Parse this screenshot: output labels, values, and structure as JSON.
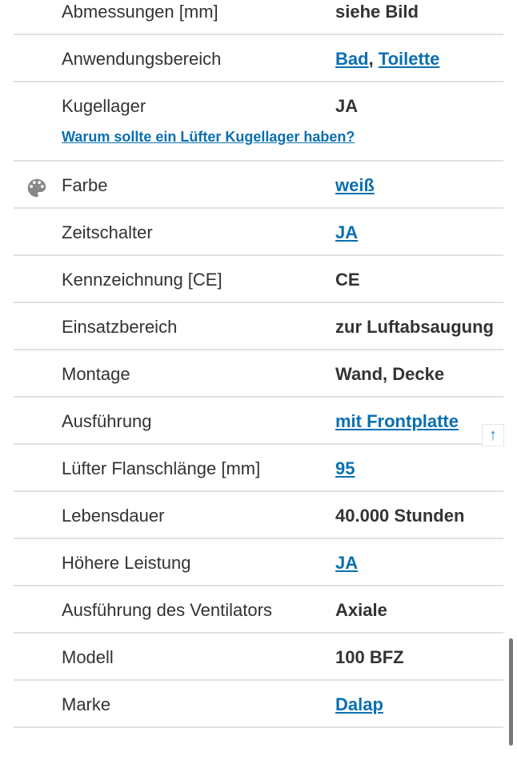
{
  "rows": [
    {
      "label": "Abmessungen [mm]",
      "value": "siehe Bild"
    },
    {
      "label": "Anwendungsbereich",
      "links": [
        "Bad",
        "Toilette"
      ],
      "separator": ", "
    },
    {
      "label": "Kugellager",
      "value": "JA",
      "sublink": "Warum sollte ein Lüfter Kugellager haben?"
    },
    {
      "label": "Farbe",
      "link": "weiß",
      "icon": "palette-icon"
    },
    {
      "label": "Zeitschalter",
      "link": "JA"
    },
    {
      "label": "Kennzeichnung [CE]",
      "value": "CE"
    },
    {
      "label": "Einsatzbereich",
      "value": "zur Luftabsaugung"
    },
    {
      "label": "Montage",
      "value": "Wand, Decke"
    },
    {
      "label": "Ausführung",
      "link": "mit Frontplatte"
    },
    {
      "label": "Lüfter Flanschlänge [mm]",
      "link": "95"
    },
    {
      "label": "Lebensdauer",
      "value": "40.000 Stunden"
    },
    {
      "label": "Höhere Leistung",
      "link": "JA"
    },
    {
      "label": "Ausführung des Ventilators",
      "value": "Axiale"
    },
    {
      "label": "Modell",
      "value": "100 BFZ"
    },
    {
      "label": "Marke",
      "link": "Dalap"
    }
  ],
  "scroll_top_icon": "arrow-up-icon",
  "colors": {
    "link": "#0a6fb0",
    "divider": "#dfe1e4",
    "text": "#333333"
  }
}
